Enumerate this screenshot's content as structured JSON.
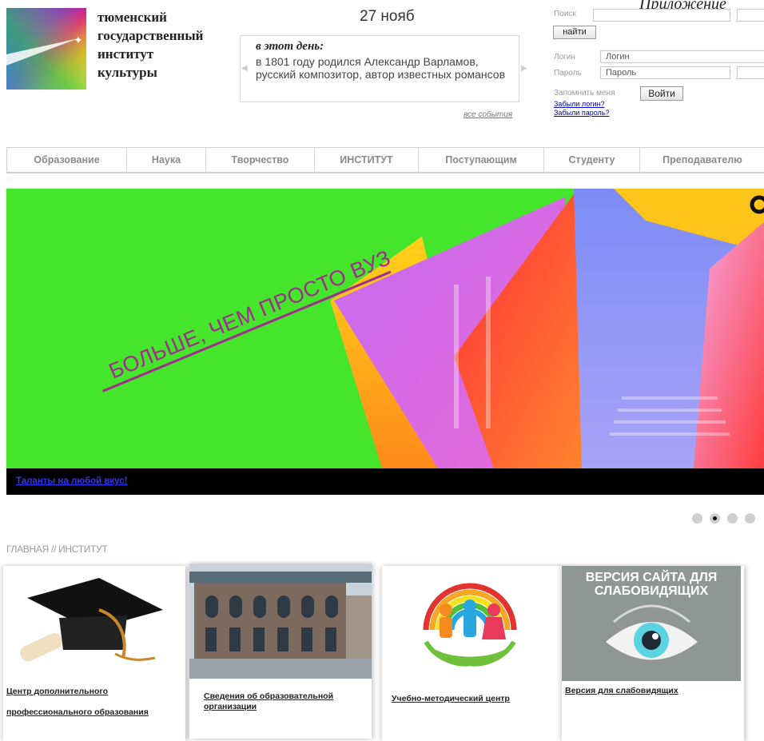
{
  "corner_note": "Приложение",
  "logo": {
    "lines": [
      "тюменский",
      "государственный",
      "институт",
      "культуры"
    ]
  },
  "event": {
    "date": "27 нояб",
    "heading": "в этот день:",
    "text": "в 1801 году родился Александр Варламов, русский композитор, автор известных романсов",
    "all_link": "все события"
  },
  "search": {
    "label": "Поиск",
    "value": "",
    "button": "найти"
  },
  "login": {
    "login_label": "Логин",
    "login_placeholder": "Логин",
    "password_label": "Пароль",
    "password_placeholder": "Пароль",
    "remember_label": "Запомнить меня",
    "submit": "Войти",
    "forgot_login": "Забыли логин?",
    "forgot_password": "Забыли пароль?"
  },
  "nav": {
    "items": [
      "Образование",
      "Наука",
      "Творчество",
      "ИНСТИТУТ",
      "Поступающим",
      "Студенту",
      "Преподавателю"
    ]
  },
  "banner": {
    "slogan": "БОЛЬШЕ, ЧЕМ ПРОСТО ВУЗ",
    "caption": "Таланты на любой вкус!",
    "background_color": "#44e52a",
    "slogan_color": "#a22b8f"
  },
  "slider": {
    "active_index": 1,
    "count": 4
  },
  "breadcrumb": "ГЛАВНАЯ // ИНСТИТУТ",
  "cards": [
    {
      "title": "Центр дополнительного профессионального образования",
      "icon": "graduation-cap-icon"
    },
    {
      "title": "Сведения об образовательной организации",
      "icon": "building-photo"
    },
    {
      "title": "Учебно-методический центр",
      "icon": "children-rainbow-icon"
    },
    {
      "title": "Версия для слабовидящих",
      "image_text": "ВЕРСИЯ САЙТА ДЛЯ СЛАБОВИДЯЩИХ",
      "icon": "eye-icon"
    }
  ]
}
